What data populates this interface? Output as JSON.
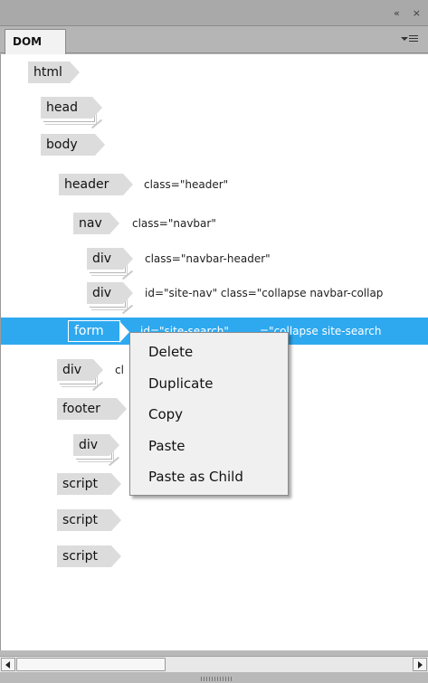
{
  "panel": {
    "collapse_glyph": "«",
    "close_glyph": "×",
    "tab_label": "DOM"
  },
  "tree": [
    {
      "tag": "html",
      "attr": ""
    },
    {
      "tag": "head",
      "attr": ""
    },
    {
      "tag": "body",
      "attr": ""
    },
    {
      "tag": "header",
      "attr": "class=\"header\""
    },
    {
      "tag": "nav",
      "attr": "class=\"navbar\""
    },
    {
      "tag": "div",
      "attr": "class=\"navbar-header\""
    },
    {
      "tag": "div",
      "attr": "id=\"site-nav\" class=\"collapse navbar-collap"
    },
    {
      "tag": "form",
      "attr_pre": "id=\"site-search\"",
      "attr": "=\"collapse site-search"
    },
    {
      "tag": "div",
      "attr": "cl"
    },
    {
      "tag": "footer",
      "attr": ""
    },
    {
      "tag": "div",
      "attr": ""
    },
    {
      "tag": "script",
      "attr": ""
    },
    {
      "tag": "script",
      "attr": ""
    },
    {
      "tag": "script",
      "attr": ""
    }
  ],
  "selected_index": 7,
  "context_menu": {
    "items": [
      "Delete",
      "Duplicate",
      "Copy",
      "Paste",
      "Paste as Child"
    ]
  }
}
